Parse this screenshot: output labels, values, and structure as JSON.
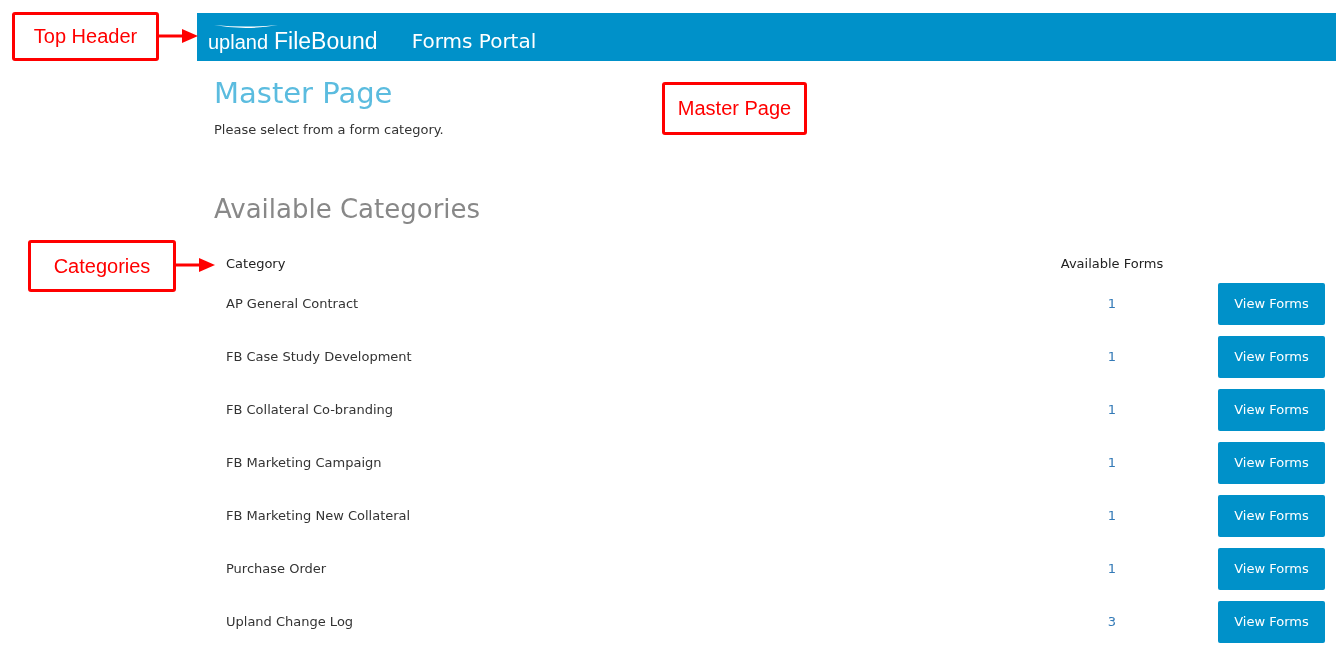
{
  "header": {
    "logo_brand": "upland",
    "logo_product": "FileBound",
    "title": "Forms Portal"
  },
  "page": {
    "title": "Master Page",
    "subtitle": "Please select from a form category."
  },
  "section_title": "Available Categories",
  "table": {
    "columns": [
      "Category",
      "Available Forms"
    ],
    "rows": [
      {
        "category": "AP General Contract",
        "available_forms": "1",
        "action": "View Forms"
      },
      {
        "category": "FB Case Study Development",
        "available_forms": "1",
        "action": "View Forms"
      },
      {
        "category": "FB Collateral Co-branding",
        "available_forms": "1",
        "action": "View Forms"
      },
      {
        "category": "FB Marketing Campaign",
        "available_forms": "1",
        "action": "View Forms"
      },
      {
        "category": "FB Marketing New Collateral",
        "available_forms": "1",
        "action": "View Forms"
      },
      {
        "category": "Purchase Order",
        "available_forms": "1",
        "action": "View Forms"
      },
      {
        "category": "Upland Change Log",
        "available_forms": "3",
        "action": "View Forms"
      }
    ]
  },
  "annotations": [
    {
      "text": "Top Header",
      "arrow": true
    },
    {
      "text": "Master Page",
      "arrow": false
    },
    {
      "text": "Categories",
      "arrow": true
    }
  ]
}
